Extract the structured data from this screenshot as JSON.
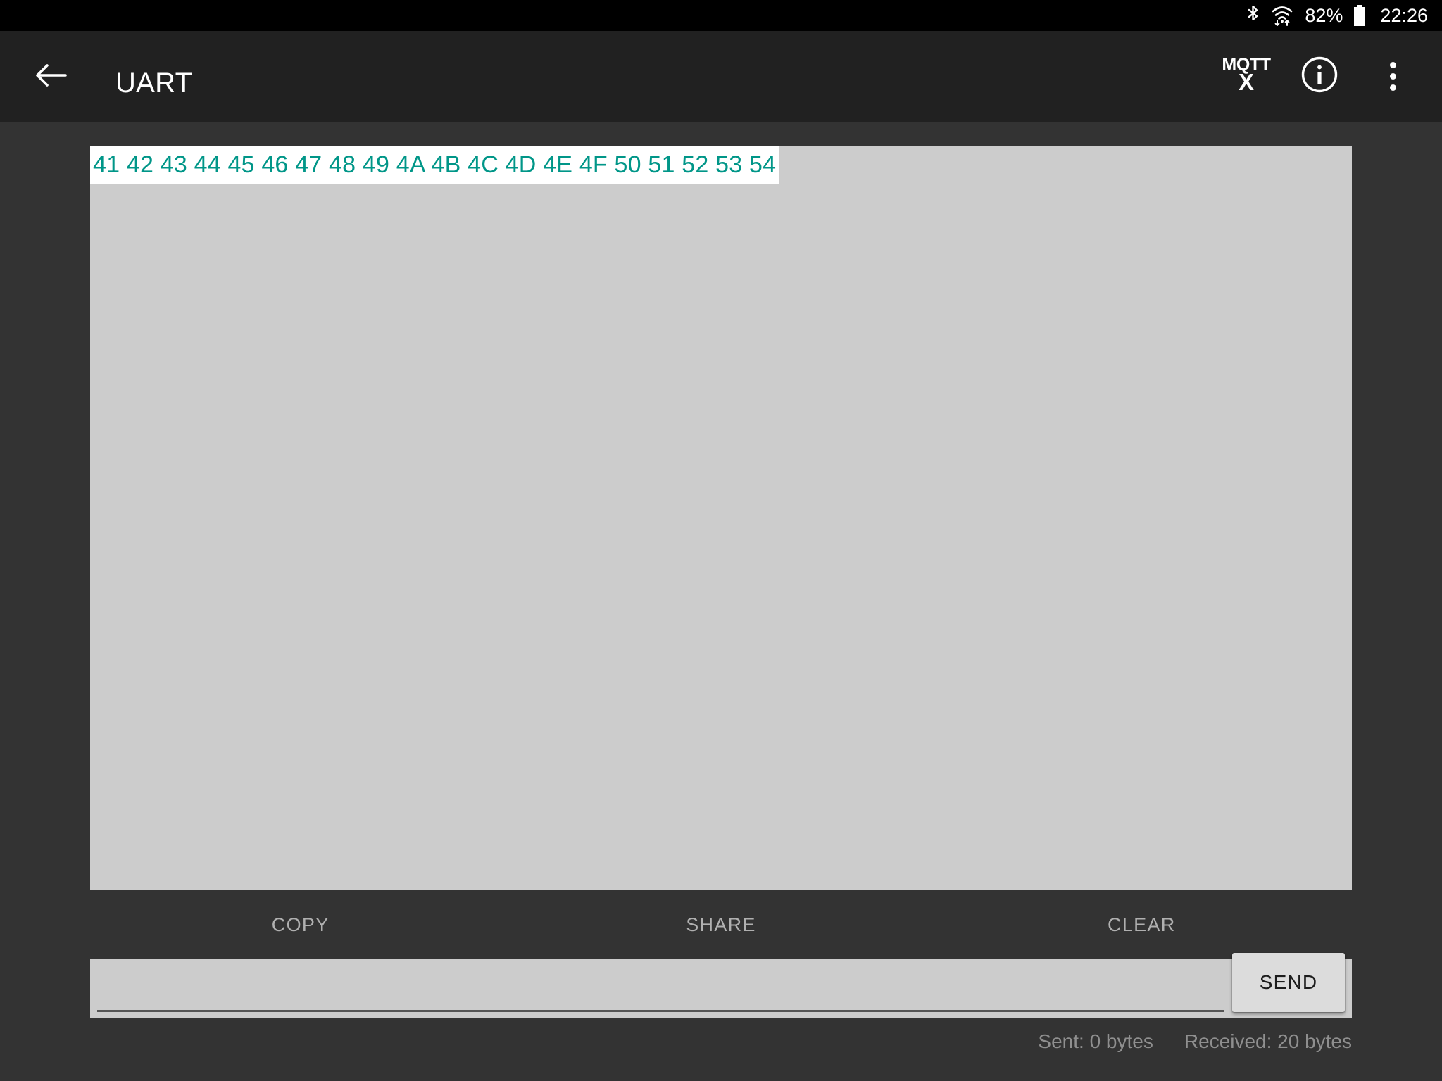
{
  "status_bar": {
    "bluetooth_icon": "bluetooth-icon",
    "wifi_icon": "wifi-icon",
    "battery_percent": "82%",
    "battery_icon": "battery-icon",
    "time": "22:26"
  },
  "app_bar": {
    "back_icon": "back-arrow-icon",
    "title": "UART",
    "mqttx_logo_top": "MQTT",
    "mqttx_logo_bottom": "X",
    "info_icon": "info-icon",
    "overflow_icon": "overflow-menu-icon"
  },
  "terminal": {
    "lines": [
      "41 42 43 44 45 46 47 48 49 4A 4B 4C 4D 4E 4F 50 51 52 53 54"
    ],
    "text_color": "#009688",
    "selection_bg": "#ffffff",
    "background": "#cccccc"
  },
  "actions": {
    "copy_label": "COPY",
    "share_label": "SHARE",
    "clear_label": "CLEAR"
  },
  "send": {
    "input_value": "",
    "input_placeholder": "",
    "button_label": "SEND"
  },
  "footer": {
    "sent": "Sent: 0 bytes",
    "received": "Received: 20 bytes"
  },
  "theme": {
    "status_bar_bg": "#000000",
    "app_bar_bg": "#212121",
    "body_bg": "#333333",
    "accent": "#009688",
    "muted_text": "#8f8f8f"
  }
}
